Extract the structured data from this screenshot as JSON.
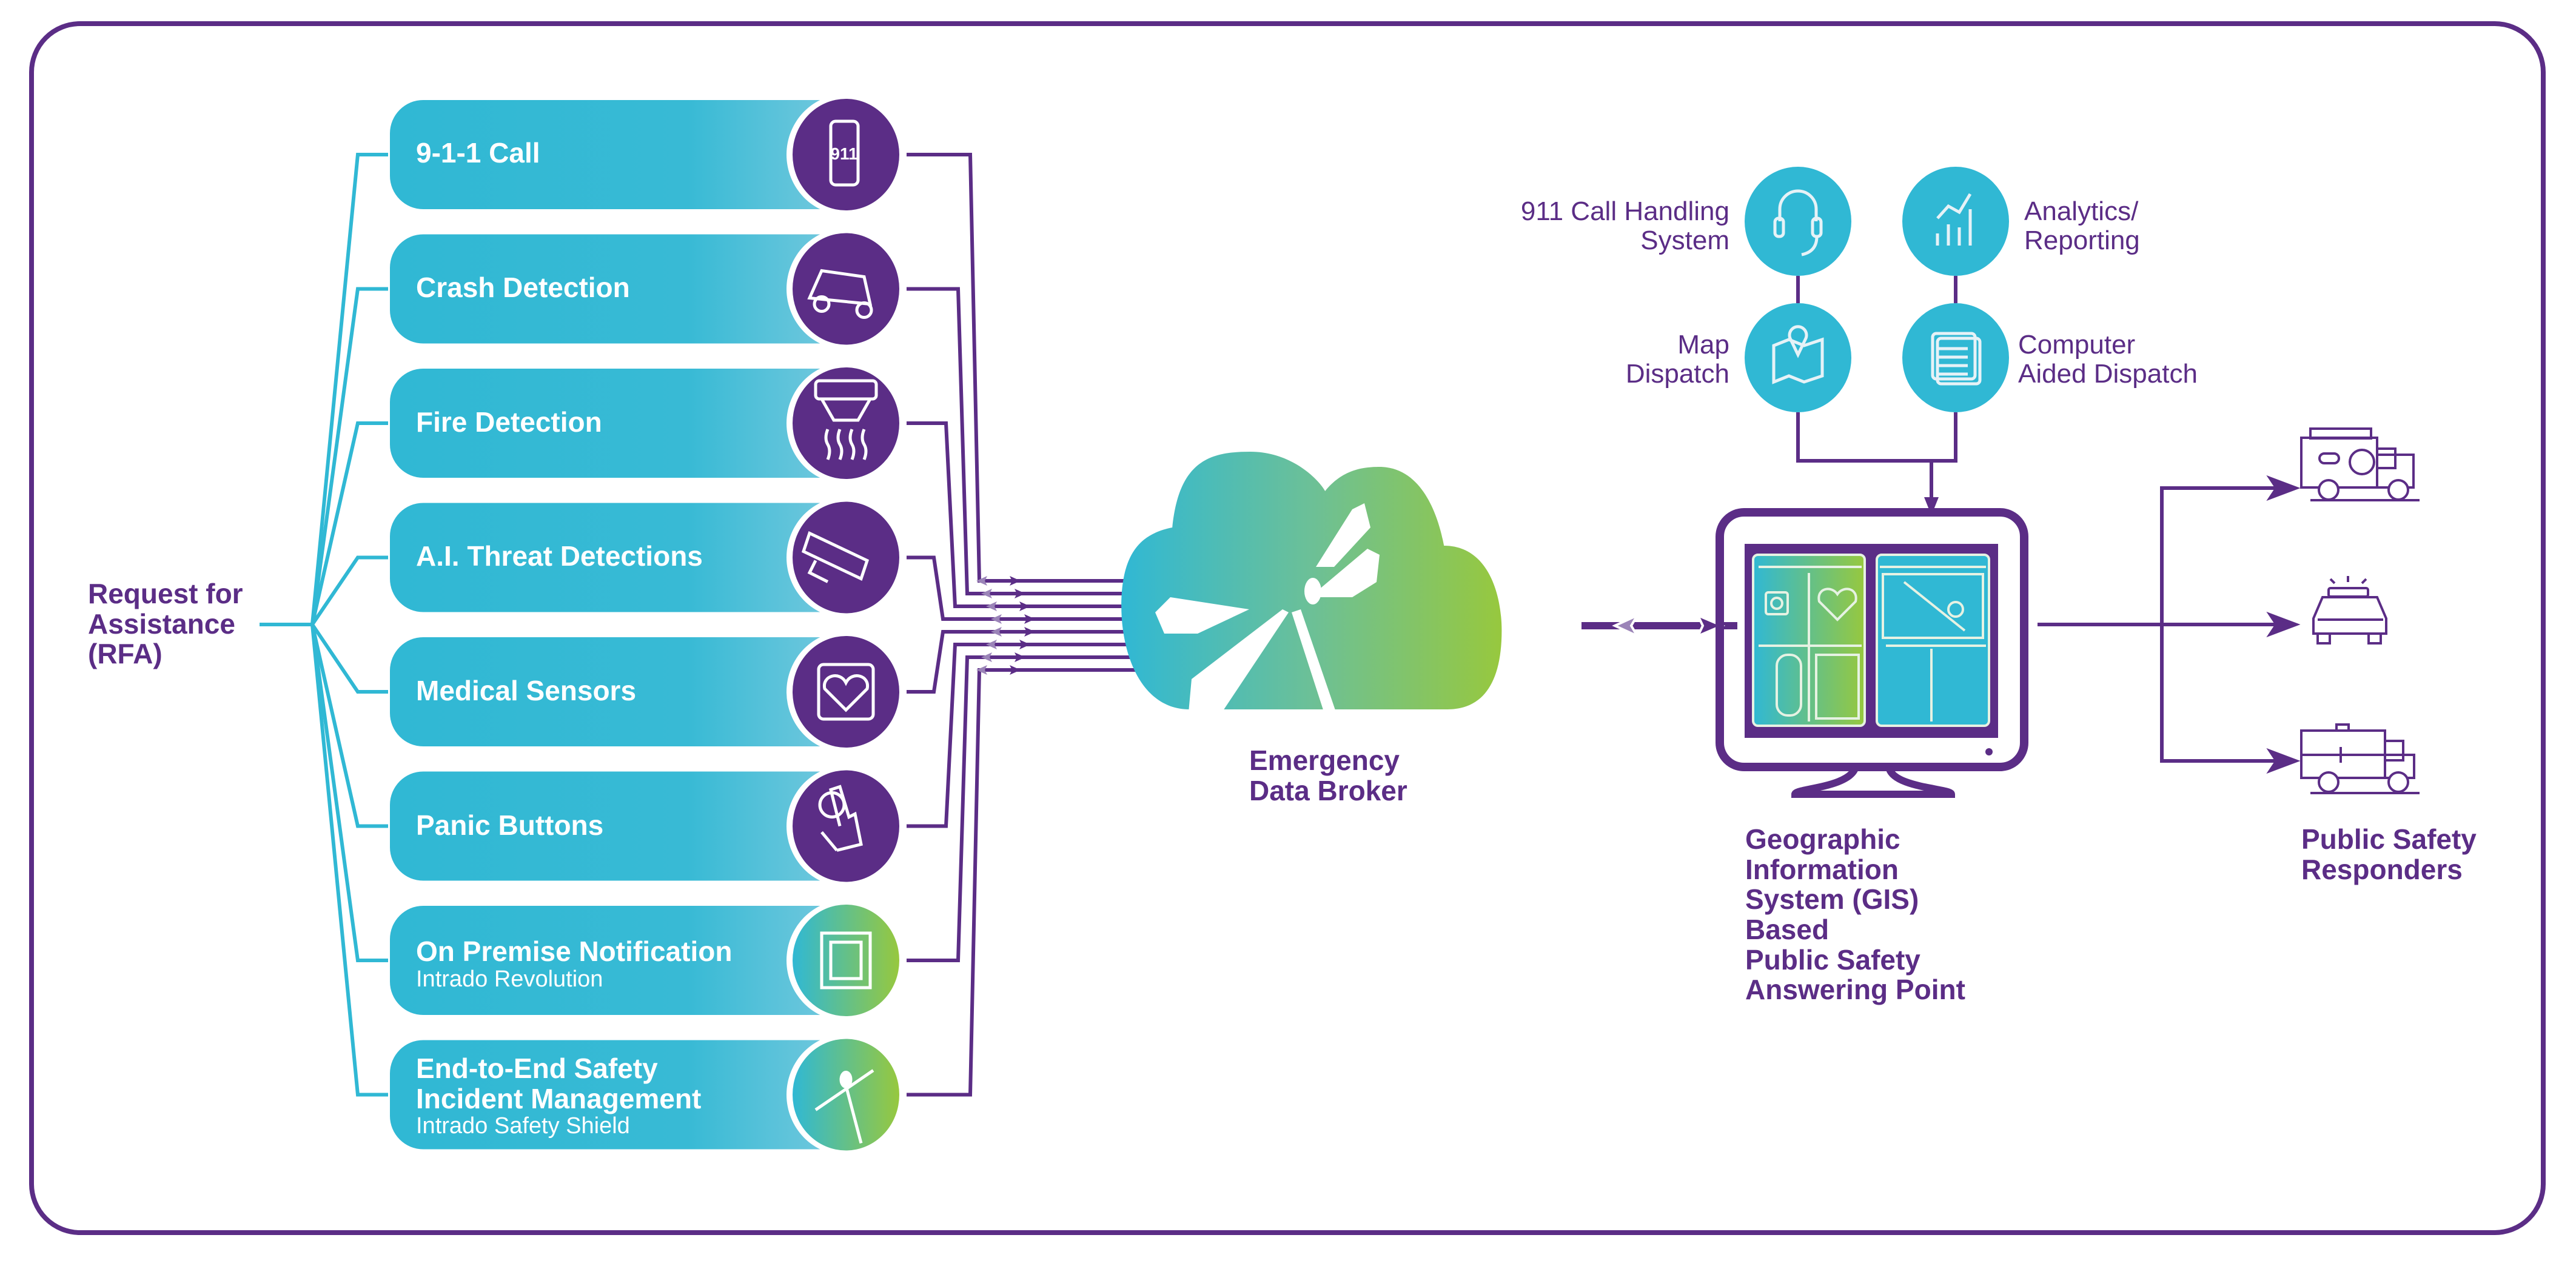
{
  "colors": {
    "purple": "#5b2d86",
    "light_purple": "#9b84b8",
    "cyan": "#30b8d4",
    "green": "#97c83e",
    "white": "#ffffff"
  },
  "source": {
    "label_lines": [
      "Request for",
      "Assistance",
      "(RFA)"
    ]
  },
  "items": [
    {
      "title": "9-1-1 Call",
      "subtitle": "",
      "icon": "phone-911-icon"
    },
    {
      "title": "Crash Detection",
      "subtitle": "",
      "icon": "crashed-car-icon"
    },
    {
      "title": "Fire Detection",
      "subtitle": "",
      "icon": "smoke-detector-icon"
    },
    {
      "title": "A.I. Threat Detections",
      "subtitle": "",
      "icon": "security-camera-icon"
    },
    {
      "title": "Medical Sensors",
      "subtitle": "",
      "icon": "smartwatch-heart-icon"
    },
    {
      "title": "Panic Buttons",
      "subtitle": "",
      "icon": "finger-press-icon"
    },
    {
      "title": "On Premise Notification",
      "subtitle": "Intrado Revolution",
      "icon": "chip-icon"
    },
    {
      "title_lines": [
        "End-to-End Safety",
        "Incident Management"
      ],
      "title": "End-to-End Safety Incident Management",
      "subtitle": "Intrado Safety Shield",
      "icon": "dragonfly-logo-icon"
    }
  ],
  "broker": {
    "label_lines": [
      "Emergency",
      "Data Broker"
    ],
    "icon": "cloud-dragonfly-icon"
  },
  "services": [
    {
      "label_lines": [
        "911 Call Handling",
        "System"
      ],
      "icon": "headset-icon"
    },
    {
      "label_lines": [
        "Analytics/",
        "Reporting"
      ],
      "icon": "analytics-chart-icon"
    },
    {
      "label_lines": [
        "Map",
        "Dispatch"
      ],
      "icon": "map-pin-icon"
    },
    {
      "label_lines": [
        "Computer",
        "Aided Dispatch"
      ],
      "icon": "dispatch-window-icon"
    }
  ],
  "psap": {
    "label_lines": [
      "Geographic",
      "Information",
      "System (GIS)",
      "Based",
      "Public Safety",
      "Answering Point"
    ],
    "icon": "monitor-dashboard-icon"
  },
  "responders": {
    "label_lines": [
      "Public Safety",
      "Responders"
    ],
    "vehicles": [
      {
        "name": "fire-truck-icon"
      },
      {
        "name": "police-car-icon"
      },
      {
        "name": "ambulance-icon"
      }
    ]
  }
}
